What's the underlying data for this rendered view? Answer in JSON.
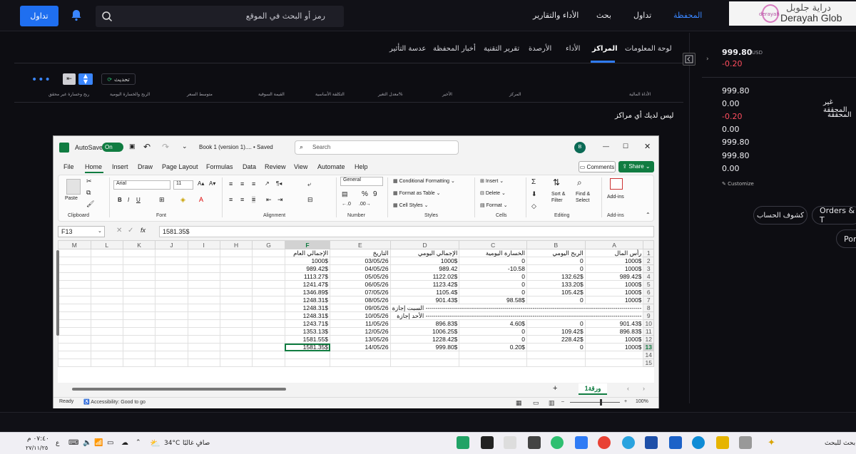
{
  "nav": {
    "trade_button": "تداول",
    "search_placeholder": "رمز أو البحث في الموقع",
    "items": [
      "المحفظة",
      "تداول",
      "بحث",
      "الأداء والتقارير"
    ],
    "logo_ar": "دراية جلوبل",
    "logo_en": "Derayah Glob",
    "logo_mark": "derayah",
    "accent": "#1f6ff0"
  },
  "tabs": [
    "لوحة المعلومات",
    "المراكز",
    "الأداء",
    "الأرصدة",
    "تقرير التقنية",
    "أخبار المحفظة",
    "عدسة التأثير"
  ],
  "toolbar": {
    "more": "•••",
    "refresh": "تحديث"
  },
  "columns": [
    "الأداة المالية",
    "المركز",
    "الأخير",
    "معدل التغير%",
    "التكلفة الأساسية",
    "القيمة السوقية",
    "متوسط السعر",
    "الربح والخسارة اليومية",
    "ربح وخسارة غير محقق"
  ],
  "empty_message": "ليس لديك أي مراكز",
  "right_panel": {
    "value": "999.80",
    "currency": "USD",
    "change": "-0.20",
    "rows": [
      {
        "value": "999.80",
        "label": ""
      },
      {
        "value": "0.00",
        "label": "غير المحققة"
      },
      {
        "value": "-0.20",
        "label": "المحققة"
      },
      {
        "value": "0.00",
        "label": ""
      },
      {
        "value": "999.80",
        "label": ""
      },
      {
        "value": "999.80",
        "label": ""
      },
      {
        "value": "0.00",
        "label": ""
      }
    ],
    "customize": "Customize",
    "statement_button": "كشوف الحساب",
    "orders_button": "Orders & T",
    "port_button": "Por"
  },
  "excel": {
    "autosave": "AutoSave",
    "autosave_state": "On",
    "title": "Book 1 (version 1).... • Saved",
    "search_placeholder": "Search",
    "avatar": "B",
    "menus": [
      "File",
      "Home",
      "Insert",
      "Draw",
      "Page Layout",
      "Formulas",
      "Data",
      "Review",
      "View",
      "Automate",
      "Help"
    ],
    "comments": "Comments",
    "share": "Share",
    "ribbon": {
      "paste": "Paste",
      "clipboard": "Clipboard",
      "font_name": "Arial",
      "font_size": "11",
      "font": "Font",
      "alignment": "Alignment",
      "number_format": "General",
      "number": "Number",
      "cond_format": "Conditional Formatting",
      "format_table": "Format as Table",
      "cell_styles": "Cell Styles",
      "styles": "Styles",
      "insert": "Insert",
      "delete": "Delete",
      "format": "Format",
      "cells": "Cells",
      "sort_filter": "Sort & Filter",
      "find_select": "Find & Select",
      "editing": "Editing",
      "addins": "Add-ins",
      "addins_group": "Add-ins"
    },
    "name_box": "F13",
    "formula": "1581.35$",
    "col_headers": [
      "M",
      "L",
      "K",
      "J",
      "I",
      "H",
      "G",
      "F",
      "E",
      "D",
      "C",
      "B",
      "A"
    ],
    "rows": [
      {
        "n": "1",
        "F": "الإجمالي العام",
        "E": "التاريخ",
        "D": "الإجمالي اليومي",
        "C": "الخسارة اليومية",
        "B": "الربح اليومي",
        "A": "رأس المال"
      },
      {
        "n": "2",
        "F": "1000$",
        "E": "03/05/26",
        "D": "1000$",
        "C": "0",
        "B": "0",
        "A": "1000$"
      },
      {
        "n": "3",
        "F": "989.42$",
        "E": "04/05/26",
        "D": "989.42",
        "C": "-10.58",
        "B": "0",
        "A": "1000$"
      },
      {
        "n": "4",
        "F": "1113.27$",
        "E": "05/05/26",
        "D": "1122.02$",
        "C": "0",
        "B": "132.62$",
        "A": "989.42$"
      },
      {
        "n": "5",
        "F": "1241.47$",
        "E": "06/05/26",
        "D": "1123.42$",
        "C": "0",
        "B": "133.20$",
        "A": "1000$"
      },
      {
        "n": "6",
        "F": "1346.89$",
        "E": "07/05/26",
        "D": "1105.4$",
        "C": "0",
        "B": "105.42$",
        "A": "1000$"
      },
      {
        "n": "7",
        "F": "1248.31$",
        "E": "08/05/26",
        "D": "901.43$",
        "C": "98.58$",
        "B": "0",
        "A": "1000$"
      },
      {
        "n": "8",
        "F": "1248.31$",
        "E": "09/05/26",
        "note": "السبت إجازة -----------------------------------------------------------------------------------------------------------"
      },
      {
        "n": "9",
        "F": "1248.31$",
        "E": "10/05/26",
        "note": "الأحد إجازة -----------------------------------------------------------------------------------------------------------"
      },
      {
        "n": "10",
        "F": "1243.71$",
        "E": "11/05/26",
        "D": "896.83$",
        "C": "4.60$",
        "B": "0",
        "A": "901.43$"
      },
      {
        "n": "11",
        "F": "1353.13$",
        "E": "12/05/26",
        "D": "1006.25$",
        "C": "0",
        "B": "109.42$",
        "A": "896.83$"
      },
      {
        "n": "12",
        "F": "1581.55$",
        "E": "13/05/26",
        "D": "1228.42$",
        "C": "0",
        "B": "228.42$",
        "A": "1000$"
      },
      {
        "n": "13",
        "F": "1581.35$",
        "E": "14/05/26",
        "D": "999.80$",
        "C": "0.20$",
        "B": "0",
        "A": "1000$"
      },
      {
        "n": "14"
      },
      {
        "n": "15"
      }
    ],
    "sheet_tab": "ورقة1",
    "status_ready": "Ready",
    "accessibility": "Accessibility: Good to go",
    "zoom": "100%"
  },
  "taskbar": {
    "time": "٠٧:٤٠ م",
    "date": "٢٧/١١/٢٥",
    "lang": "ع",
    "temp": "34°C",
    "weather": "صافٍ غالبًا",
    "search": "بحث للبحث"
  }
}
